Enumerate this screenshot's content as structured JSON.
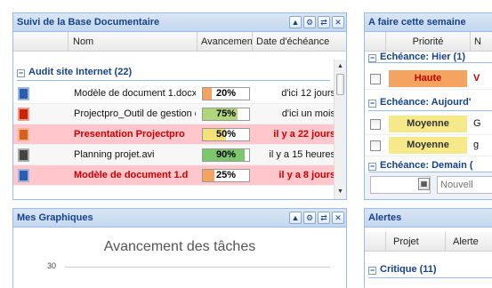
{
  "suivi": {
    "title": "Suivi de la Base Documentaire",
    "columns": {
      "name": "Nom",
      "progress": "Avancement",
      "due": "Date d'échéance"
    },
    "group": "Audit site Internet (22)",
    "rows": [
      {
        "icon": "word-doc-icon",
        "icon_color": "#2a5db0",
        "name": "Modèle de document 1.docx",
        "pct_label": "20%",
        "progress": 0.2,
        "bar_color": "#f4a460",
        "due": "d'ici 12 jours",
        "late": false
      },
      {
        "icon": "pdf-icon",
        "icon_color": "#cc2200",
        "name": "Projectpro_Outil de gestion de",
        "pct_label": "75%",
        "progress": 0.75,
        "bar_color": "#b0d67a",
        "due": "d'ici un mois",
        "late": false
      },
      {
        "icon": "powerpoint-icon",
        "icon_color": "#d86018",
        "name": "Presentation Projectpro",
        "pct_label": "50%",
        "progress": 0.5,
        "bar_color": "#f3e27a",
        "due": "il y a 22 jours",
        "late": true
      },
      {
        "icon": "video-film-icon",
        "icon_color": "#444444",
        "name": "Planning projet.avi",
        "pct_label": "90%",
        "progress": 0.9,
        "bar_color": "#7cc66e",
        "due": "il y a 15 heures",
        "late": false
      },
      {
        "icon": "word-doc-icon",
        "icon_color": "#2a5db0",
        "name": "Modèle de document 1.d",
        "pct_label": "25%",
        "progress": 0.25,
        "bar_color": "#f4a460",
        "due": "il y a 8 jours",
        "late": true
      }
    ]
  },
  "afaire": {
    "title": "A faire cette semaine",
    "columns": {
      "priority": "Priorité",
      "next": "N"
    },
    "group_hier": "Echéance: Hier (1)",
    "group_auj": "Echéance: Aujourd'",
    "group_demain": "Echéance: Demain (",
    "rows": [
      {
        "priority": "Haute",
        "color": "#f4a460",
        "text_color": "#cc0000",
        "extra": "V"
      },
      {
        "priority": "Moyenne",
        "color": "#f6e98a",
        "text_color": "#333333",
        "extra": "G"
      },
      {
        "priority": "Moyenne",
        "color": "#f6e98a",
        "text_color": "#333333",
        "extra": "g"
      }
    ],
    "placeholder_new": "Nouvell"
  },
  "graphiques": {
    "title": "Mes Graphiques"
  },
  "chart_data": {
    "type": "bar",
    "title": "Avancement des tâches",
    "yticks": [
      30
    ],
    "categories": [],
    "values": []
  },
  "alertes": {
    "title": "Alertes",
    "columns": {
      "project": "Projet",
      "alert": "Alerte"
    },
    "group": "Critique (11)"
  },
  "tool_icons": {
    "collapse": "▲",
    "settings": "⚙",
    "refresh": "⇄",
    "close": "✕"
  }
}
